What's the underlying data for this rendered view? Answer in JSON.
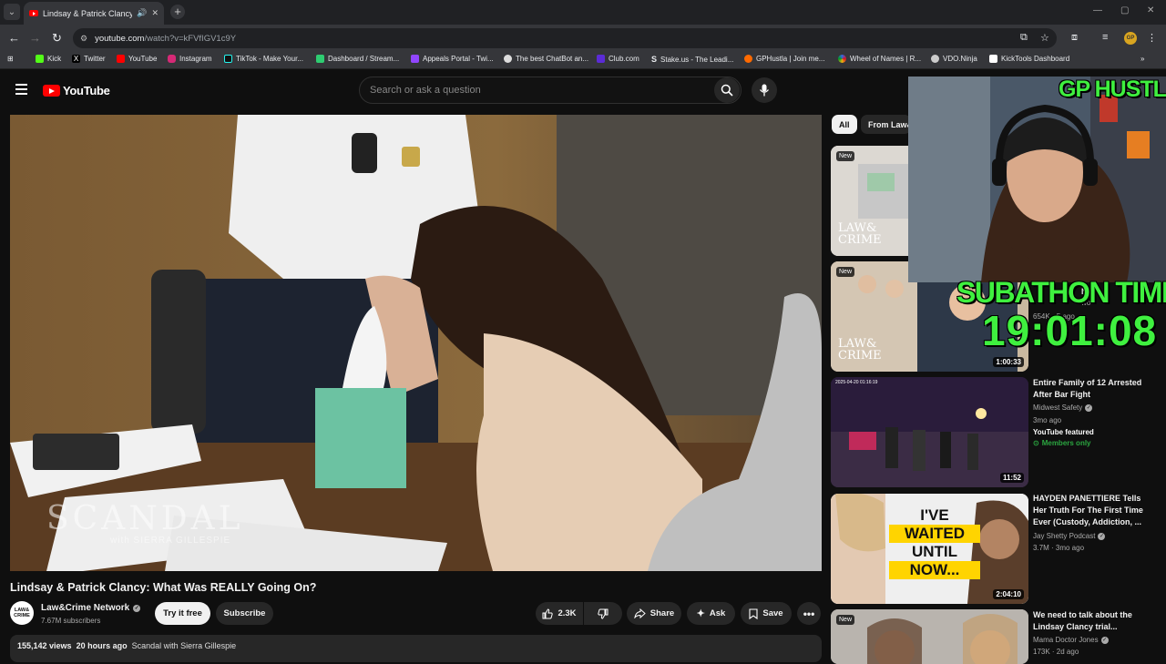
{
  "browser": {
    "tab_title": "Lindsay & Patrick Clancy: W",
    "url_host": "youtube.com",
    "url_path": "/watch?v=kFVfIGV1c9Y",
    "profile_initials": "GP",
    "bookmarks": [
      {
        "label": "Kick",
        "color": "#53fc18"
      },
      {
        "label": "Twitter",
        "color": "#000000"
      },
      {
        "label": "YouTube",
        "color": "#ff0000"
      },
      {
        "label": "Instagram",
        "color": "#d62976"
      },
      {
        "label": "TikTok - Make Your...",
        "color": "#111111"
      },
      {
        "label": "Dashboard / Stream...",
        "color": "#2ecc71"
      },
      {
        "label": "Appeals Portal - Twi...",
        "color": "#9146ff"
      },
      {
        "label": "The best ChatBot an...",
        "color": "#dddddd"
      },
      {
        "label": "Club.com",
        "color": "#5b2bd6"
      },
      {
        "label": "Stake.us - The Leadi...",
        "color": "#1a2c38"
      },
      {
        "label": "GPHustla | Join me...",
        "color": "#ff6a00"
      },
      {
        "label": "Wheel of Names | R...",
        "color": "#3369e8"
      },
      {
        "label": "VDO.Ninja",
        "color": "#cccccc"
      },
      {
        "label": "KickTools Dashboard",
        "color": "#ffffff"
      }
    ]
  },
  "youtube": {
    "logo_text": "YouTube",
    "search_placeholder": "Search or ask a question"
  },
  "video": {
    "title": "Lindsay & Patrick Clancy: What Was REALLY Going On?",
    "watermark_title": "SCANDAL",
    "watermark_sub": "with SIERRA GILLESPIE",
    "channel_name": "Law&Crime Network",
    "channel_avatar_text": "LAW& CRIME",
    "subscribers": "7.67M subscribers",
    "try_label": "Try it free",
    "subscribe_label": "Subscribe",
    "likes": "2.3K",
    "share_label": "Share",
    "ask_label": "Ask",
    "save_label": "Save",
    "views": "155,142 views",
    "age": "20 hours ago",
    "description": "Scandal with Sierra Gillespie"
  },
  "chips": [
    "All",
    "From Law&"
  ],
  "recommendations": [
    {
      "new": "New",
      "thumb_text": "LAW& CRIME",
      "duration": ""
    },
    {
      "new": "New",
      "thumb_text": "LAW& CRIME",
      "duration": "1:00:33",
      "meta": "654K · 5 ago",
      "title_frag": "NT",
      "chan_frag": "wo"
    },
    {
      "title": "Entire Family of 12 Arrested After Bar Fight",
      "channel": "Midwest Safety",
      "meta": "3mo ago",
      "featured": "YouTube featured",
      "members": "Members only",
      "duration": "11:52",
      "thumb_text": "2025-04-20 01:16:19"
    },
    {
      "title": "HAYDEN PANETTIERE Tells Her Truth For The First Time Ever (Custody, Addiction, ...",
      "channel": "Jay Shetty Podcast",
      "meta": "3.7M · 3mo ago",
      "duration": "2:04:10",
      "thumb_lines": [
        "I'VE",
        "WAITED",
        "UNTIL",
        "NOW..."
      ]
    },
    {
      "new": "New",
      "title": "We need to talk about the Lindsay Clancy trial...",
      "channel": "Mama Doctor Jones",
      "meta": "173K · 2d ago"
    }
  ],
  "overlay": {
    "title": "GP HUSTLA",
    "subathon_label": "SUBATHON TIMER",
    "timer": "19:01:08"
  },
  "colors": {
    "youtube_red": "#ff0000",
    "overlay_green": "#3ff03f",
    "members_green": "#2ba640"
  }
}
